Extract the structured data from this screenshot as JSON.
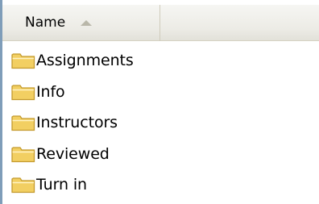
{
  "header": {
    "name_column_label": "Name",
    "sort_direction": "ascending"
  },
  "folder_icon": "folder-icon",
  "colors": {
    "folder_fill": "#f2cf62",
    "folder_outline": "#c49a2c",
    "border": "#7f9db9"
  },
  "items": [
    {
      "label": "Assignments"
    },
    {
      "label": "Info"
    },
    {
      "label": "Instructors"
    },
    {
      "label": "Reviewed"
    },
    {
      "label": "Turn in"
    }
  ]
}
